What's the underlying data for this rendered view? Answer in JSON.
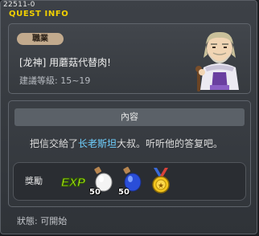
{
  "window": {
    "quest_id": "22511-0",
    "title": "QUEST INFO"
  },
  "quest": {
    "job_badge": "職業",
    "name": "[龙神] 用蘑菇代替肉!",
    "recommended_level": "建議等級: 15~19"
  },
  "content": {
    "header": "內容",
    "desc_before": "把信交給了",
    "npc_name": "长老斯坦",
    "desc_after": "大叔。听听他的答复吧。"
  },
  "rewards": {
    "label": "獎勵",
    "items": [
      {
        "icon": "exp-icon",
        "qty": ""
      },
      {
        "icon": "white-potion-icon",
        "qty": "50"
      },
      {
        "icon": "blue-potion-icon",
        "qty": "50"
      },
      {
        "icon": "medal-icon",
        "qty": ""
      }
    ]
  },
  "status": "狀態: 可開始",
  "colors": {
    "title": "#f2d000",
    "npc_name": "#6fd0ff",
    "badge": "#c2aa8d"
  }
}
